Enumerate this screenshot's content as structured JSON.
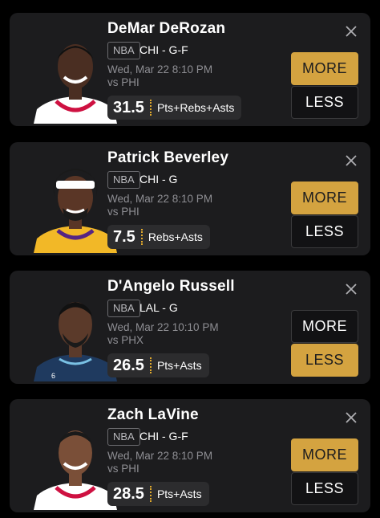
{
  "cards": [
    {
      "name": "DeMar DeRozan",
      "league": "NBA",
      "team": "CHI - G-F",
      "time": "Wed, Mar 22 8:10 PM",
      "opponent": "vs PHI",
      "line": "31.5",
      "stat": "Pts+Rebs+Asts",
      "more": "MORE",
      "less": "LESS",
      "selected": "more",
      "jersey_color": "#ffffff",
      "skin": "#4a2e22"
    },
    {
      "name": "Patrick Beverley",
      "league": "NBA",
      "team": "CHI - G",
      "time": "Wed, Mar 22 8:10 PM",
      "opponent": "vs PHI",
      "line": "7.5",
      "stat": "Rebs+Asts",
      "more": "MORE",
      "less": "LESS",
      "selected": "more",
      "jersey_color": "#f2b827",
      "skin": "#5a3626"
    },
    {
      "name": "D'Angelo Russell",
      "league": "NBA",
      "team": "LAL - G",
      "time": "Wed, Mar 22 10:10 PM",
      "opponent": "vs PHX",
      "line": "26.5",
      "stat": "Pts+Asts",
      "more": "MORE",
      "less": "LESS",
      "selected": "less",
      "jersey_color": "#1f3a5f",
      "skin": "#5b3a2a"
    },
    {
      "name": "Zach LaVine",
      "league": "NBA",
      "team": "CHI - G-F",
      "time": "Wed, Mar 22 8:10 PM",
      "opponent": "vs PHI",
      "line": "28.5",
      "stat": "Pts+Asts",
      "more": "MORE",
      "less": "LESS",
      "selected": "more",
      "jersey_color": "#ffffff",
      "skin": "#7a4f38"
    }
  ]
}
